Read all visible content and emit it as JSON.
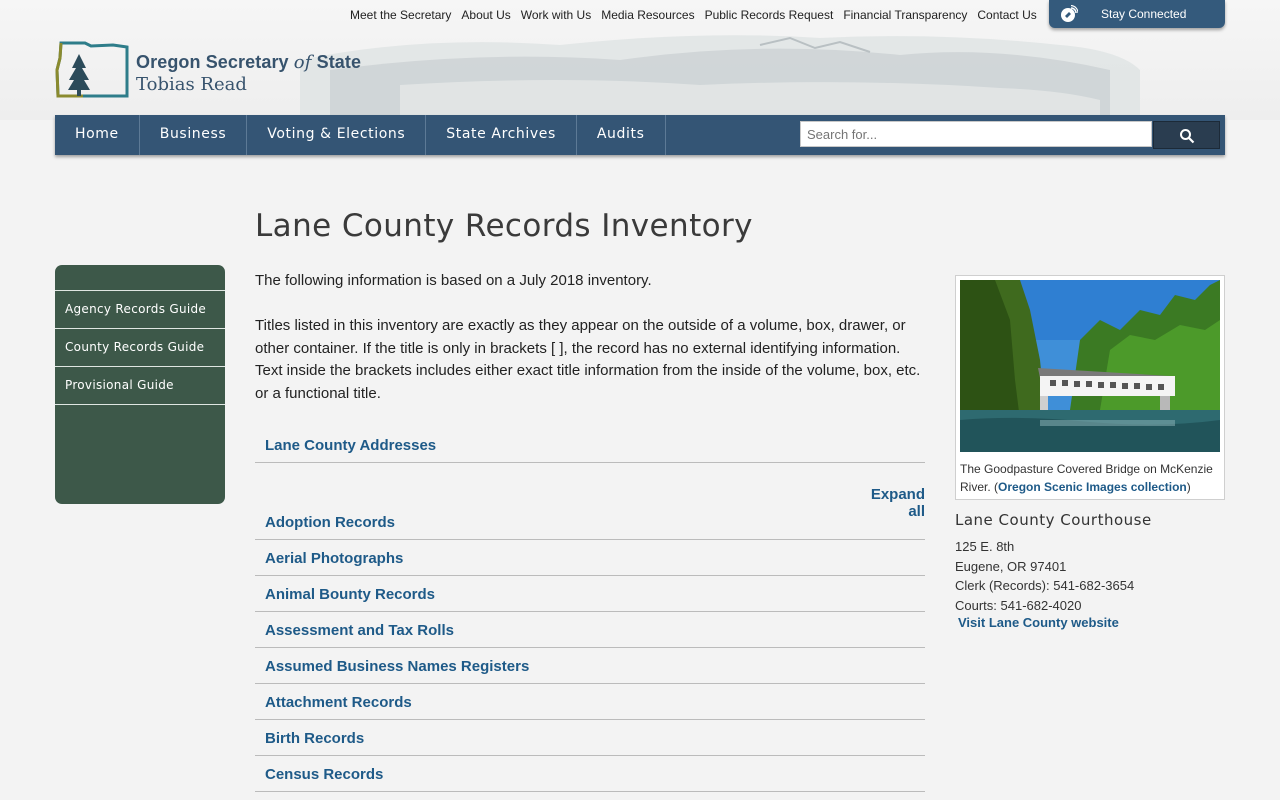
{
  "utility_nav": [
    "Meet the Secretary",
    "About Us",
    "Work with Us",
    "Media Resources",
    "Public Records Request",
    "Financial Transparency",
    "Contact Us"
  ],
  "stay_connected": "Stay Connected",
  "logo": {
    "org_name_1": "Oregon Secretary ",
    "org_name_of": "of",
    "org_name_2": " State",
    "official": "Tobias Read"
  },
  "main_nav": [
    "Home",
    "Business",
    "Voting & Elections",
    "State Archives",
    "Audits"
  ],
  "search": {
    "placeholder": "Search for..."
  },
  "sidebar": [
    "Agency Records Guide",
    "County Records Guide",
    "Provisional Guide"
  ],
  "page_title": "Lane County Records Inventory",
  "intro": {
    "p1": "The following information is based on a July 2018 inventory.",
    "p2": "Titles listed in this inventory are exactly as they appear on the outside of a volume, box, drawer, or other container. If the title is only in brackets [ ], the record has no external identifying information. Text inside the brackets includes either exact title information from the inside of the volume, box, etc. or a functional title."
  },
  "addresses_section": "Lane County Addresses",
  "expand_all": "Expand all",
  "records": [
    "Adoption Records",
    "Aerial Photographs",
    "Animal Bounty Records",
    "Assessment and Tax Rolls",
    "Assumed Business Names Registers",
    "Attachment Records",
    "Birth Records",
    "Census Records"
  ],
  "photo": {
    "caption_text": "The Goodpasture Covered Bridge on McKenzie River. (",
    "caption_link": "Oregon Scenic Images collection",
    "caption_end": ")"
  },
  "courthouse": {
    "title": "Lane County Courthouse",
    "lines": [
      "125 E. 8th",
      "Eugene, OR 97401",
      "Clerk (Records): 541-682-3654",
      "Courts: 541-682-4020"
    ],
    "link": "Visit Lane County website"
  },
  "colors": {
    "nav": "#345575",
    "sidebar": "#3d5849",
    "link": "#1e5a88",
    "search_button": "#2a3d50"
  }
}
